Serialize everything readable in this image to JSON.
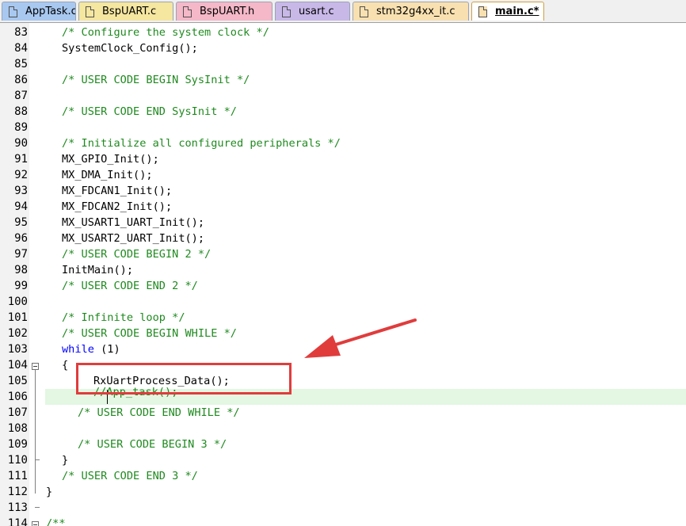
{
  "tabs": [
    {
      "label": "AppTask.c",
      "color": "#a8c8f0",
      "icon": "c-file-icon",
      "active": false
    },
    {
      "label": "BspUART.c",
      "color": "#f5e6a0",
      "icon": "c-file-icon",
      "active": false
    },
    {
      "label": "BspUART.h",
      "color": "#f4b8c8",
      "icon": "h-file-icon",
      "active": false
    },
    {
      "label": "usart.c",
      "color": "#c8b8e8",
      "icon": "c-file-icon",
      "active": false
    },
    {
      "label": "stm32g4xx_it.c",
      "color": "#f8e0b0",
      "icon": "c-file-icon",
      "active": false
    },
    {
      "label": "main.c*",
      "color": "#f8e0b0",
      "icon": "c-file-icon",
      "active": true
    }
  ],
  "lines": [
    {
      "num": "83",
      "text": "/* Configure the system clock */"
    },
    {
      "num": "84",
      "text": "SystemClock_Config();"
    },
    {
      "num": "85",
      "text": ""
    },
    {
      "num": "86",
      "text": "/* USER CODE BEGIN SysInit */"
    },
    {
      "num": "87",
      "text": ""
    },
    {
      "num": "88",
      "text": "/* USER CODE END SysInit */"
    },
    {
      "num": "89",
      "text": ""
    },
    {
      "num": "90",
      "text": "/* Initialize all configured peripherals */"
    },
    {
      "num": "91",
      "text": "MX_GPIO_Init();"
    },
    {
      "num": "92",
      "text": "MX_DMA_Init();"
    },
    {
      "num": "93",
      "text": "MX_FDCAN1_Init();"
    },
    {
      "num": "94",
      "text": "MX_FDCAN2_Init();"
    },
    {
      "num": "95",
      "text": "MX_USART1_UART_Init();"
    },
    {
      "num": "96",
      "text": "MX_USART2_UART_Init();"
    },
    {
      "num": "97",
      "text": "/* USER CODE BEGIN 2 */"
    },
    {
      "num": "98",
      "text": "InitMain();"
    },
    {
      "num": "99",
      "text": "/* USER CODE END 2 */"
    },
    {
      "num": "100",
      "text": ""
    },
    {
      "num": "101",
      "text": "/* Infinite loop */"
    },
    {
      "num": "102",
      "text": "/* USER CODE BEGIN WHILE */"
    },
    {
      "num": "103",
      "keyword": "while",
      "text": " (1)"
    },
    {
      "num": "104",
      "text": "{"
    },
    {
      "num": "105",
      "text": "RxUartProcess_Data();"
    },
    {
      "num": "106",
      "text": "//App_task();"
    },
    {
      "num": "107",
      "text": "/* USER CODE END WHILE */"
    },
    {
      "num": "108",
      "text": ""
    },
    {
      "num": "109",
      "text": "/* USER CODE BEGIN 3 */"
    },
    {
      "num": "110",
      "text": "}"
    },
    {
      "num": "111",
      "text": "/* USER CODE END 3 */"
    },
    {
      "num": "112",
      "text": "}"
    },
    {
      "num": "113",
      "text": ""
    },
    {
      "num": "114",
      "text": "/**"
    }
  ],
  "colors": {
    "comment": "#1f8a1f",
    "keyword": "#0000ff",
    "annotation": "#e03c3c",
    "current_line": "#e3f7e3"
  }
}
